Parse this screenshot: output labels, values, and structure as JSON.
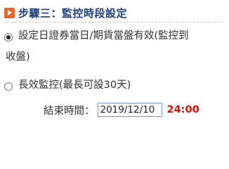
{
  "section": {
    "title": "步驟三：監控時段設定",
    "icon": "play-icon",
    "icon_color": "#e8662a",
    "title_color": "#1f3f7a"
  },
  "options": [
    {
      "label_line1": "設定日證券當日/期貨當盤有效(監控到",
      "label_line2": "收盤)",
      "checked": true
    },
    {
      "label": "長效監控(最長可設30天)",
      "checked": false
    }
  ],
  "end_time": {
    "label": "結束時間：",
    "date_value": "2019/12/10",
    "time": "24:00",
    "time_color": "#e0100a"
  }
}
